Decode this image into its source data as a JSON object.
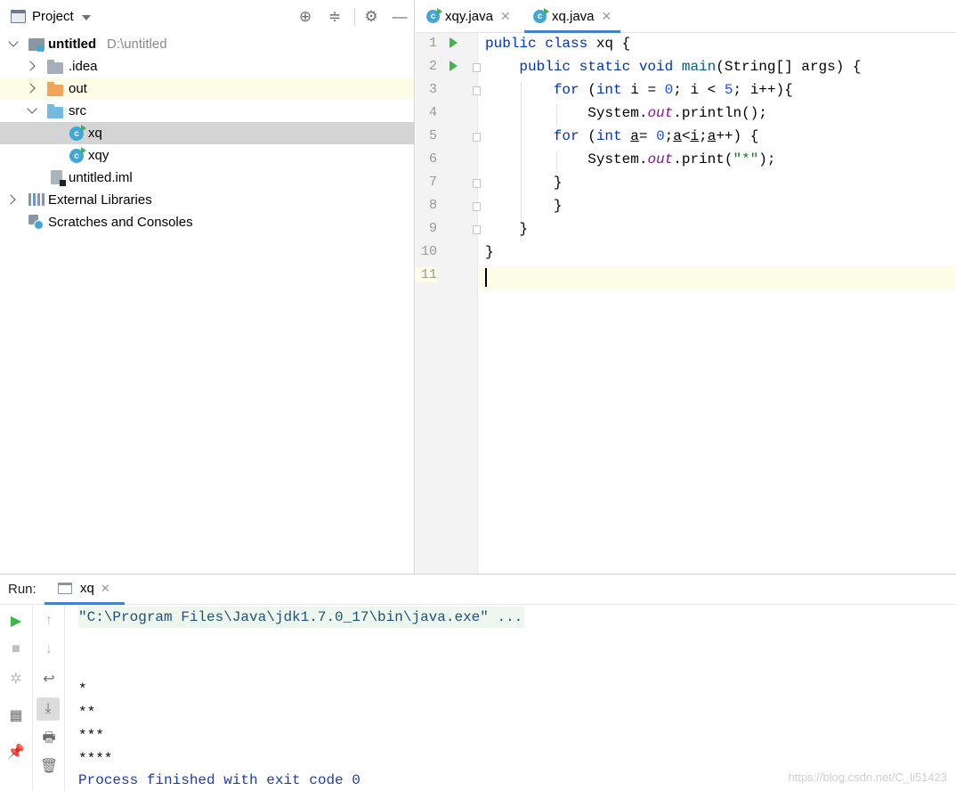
{
  "project": {
    "title": "Project",
    "tree": [
      {
        "name": "untitled",
        "path": "D:\\untitled"
      },
      {
        "name": ".idea"
      },
      {
        "name": "out"
      },
      {
        "name": "src"
      },
      {
        "name": "xq"
      },
      {
        "name": "xqy"
      },
      {
        "name": "untitled.iml"
      },
      {
        "name": "External Libraries"
      },
      {
        "name": "Scratches and Consoles"
      }
    ]
  },
  "editor": {
    "tabs": [
      {
        "label": "xqy.java",
        "close": "✕"
      },
      {
        "label": "xq.java",
        "close": "✕",
        "active": true
      }
    ],
    "line_numbers": [
      "1",
      "2",
      "3",
      "4",
      "5",
      "6",
      "7",
      "8",
      "9",
      "10",
      "11"
    ]
  },
  "run": {
    "label": "Run:",
    "tab": "xq",
    "tab_close": "✕",
    "output": [
      "\"C:\\Program Files\\Java\\jdk1.7.0_17\\bin\\java.exe\" ...",
      "",
      "*",
      "**",
      "***",
      "****",
      "Process finished with exit code 0"
    ]
  },
  "watermark": "https://blog.csdn.net/C_li51423",
  "colors": {
    "accent": "#4083c9",
    "keyword": "#0033b3",
    "run_green": "#3fb54a"
  }
}
